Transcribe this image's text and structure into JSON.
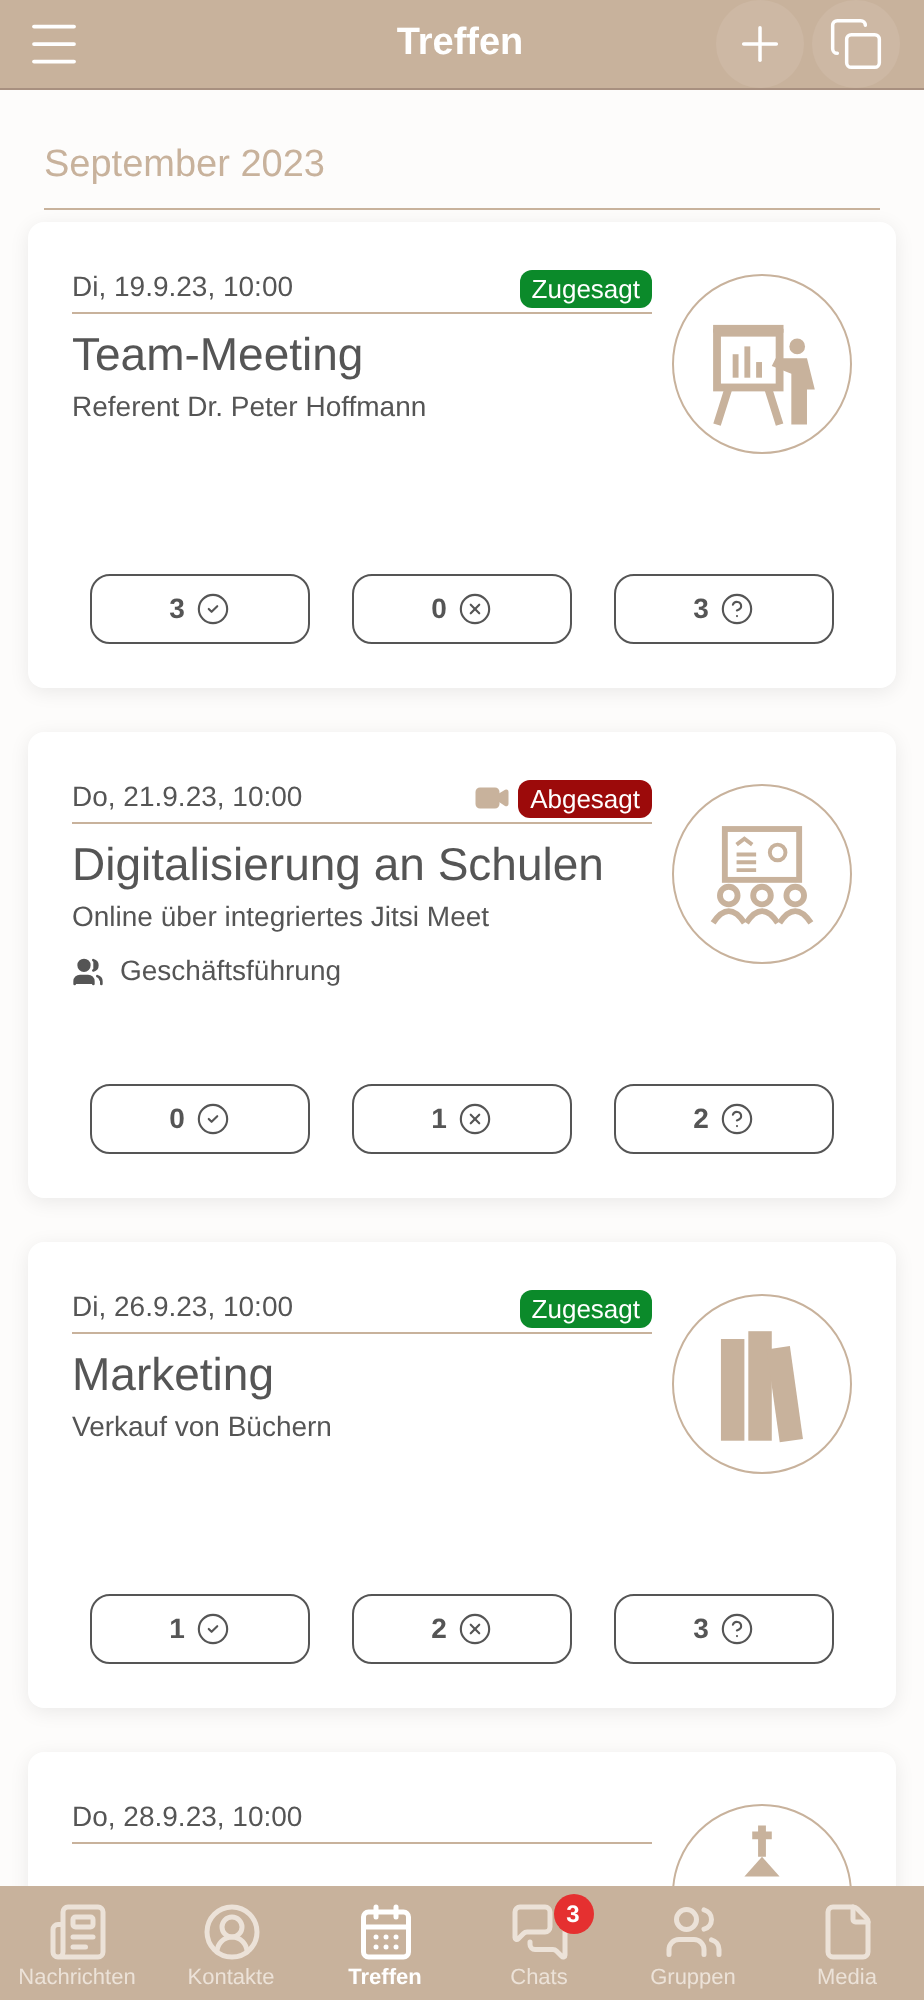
{
  "header": {
    "title": "Treffen"
  },
  "month": "September 2023",
  "meetings": [
    {
      "date": "Di, 19.9.23, 10:00",
      "status": {
        "label": "Zugesagt",
        "kind": "accepted"
      },
      "online": false,
      "title": "Team-Meeting",
      "subtitle": "Referent Dr. Peter Hoffmann",
      "kind": "presentation",
      "counts": {
        "yes": "3",
        "no": "0",
        "maybe": "3"
      }
    },
    {
      "date": "Do, 21.9.23, 10:00",
      "status": {
        "label": "Abgesagt",
        "kind": "declined"
      },
      "online": true,
      "title": "Digitalisierung an Schulen",
      "subtitle": "Online über integriertes Jitsi Meet",
      "group": "Geschäftsführung",
      "kind": "meeting",
      "counts": {
        "yes": "0",
        "no": "1",
        "maybe": "2"
      }
    },
    {
      "date": "Di, 26.9.23, 10:00",
      "status": {
        "label": "Zugesagt",
        "kind": "accepted"
      },
      "online": false,
      "title": "Marketing",
      "subtitle": "Verkauf von Büchern",
      "kind": "books",
      "counts": {
        "yes": "1",
        "no": "2",
        "maybe": "3"
      }
    },
    {
      "date": "Do, 28.9.23, 10:00",
      "online": false,
      "kind": "church"
    }
  ],
  "nav": [
    {
      "label": "Nachrichten",
      "kind": "news",
      "selected": false
    },
    {
      "label": "Kontakte",
      "kind": "contact",
      "selected": false
    },
    {
      "label": "Treffen",
      "kind": "calendar",
      "selected": true
    },
    {
      "label": "Chats",
      "kind": "chats",
      "selected": false,
      "badge": "3"
    },
    {
      "label": "Gruppen",
      "kind": "groups",
      "selected": false
    },
    {
      "label": "Media",
      "kind": "file",
      "selected": false
    }
  ]
}
